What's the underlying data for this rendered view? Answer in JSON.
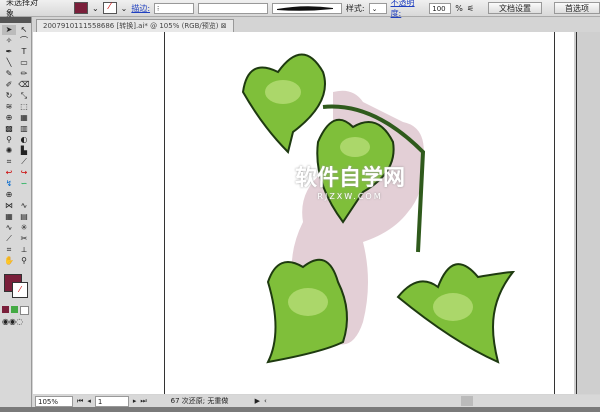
{
  "control_bar": {
    "selection": "未选择对象",
    "stroke_label": "描边:",
    "style_label": "样式:",
    "opacity_label": "不透明度:",
    "opacity_value": "100",
    "percent": "%",
    "doc_setup": "文档设置",
    "preferences": "首选项",
    "fill_color": "#7a1f3a"
  },
  "document": {
    "tab_title": "20079101115586​86 [转换].ai* @ 105% (RGB/预览)",
    "close": "⊠"
  },
  "watermark": {
    "main": "软件自学网",
    "sub": "RJZXW.COM"
  },
  "status": {
    "zoom": "105%",
    "page": "1",
    "message": "67 次还原; 无重做"
  },
  "tools": {
    "fill_color": "#7a1f3a"
  }
}
